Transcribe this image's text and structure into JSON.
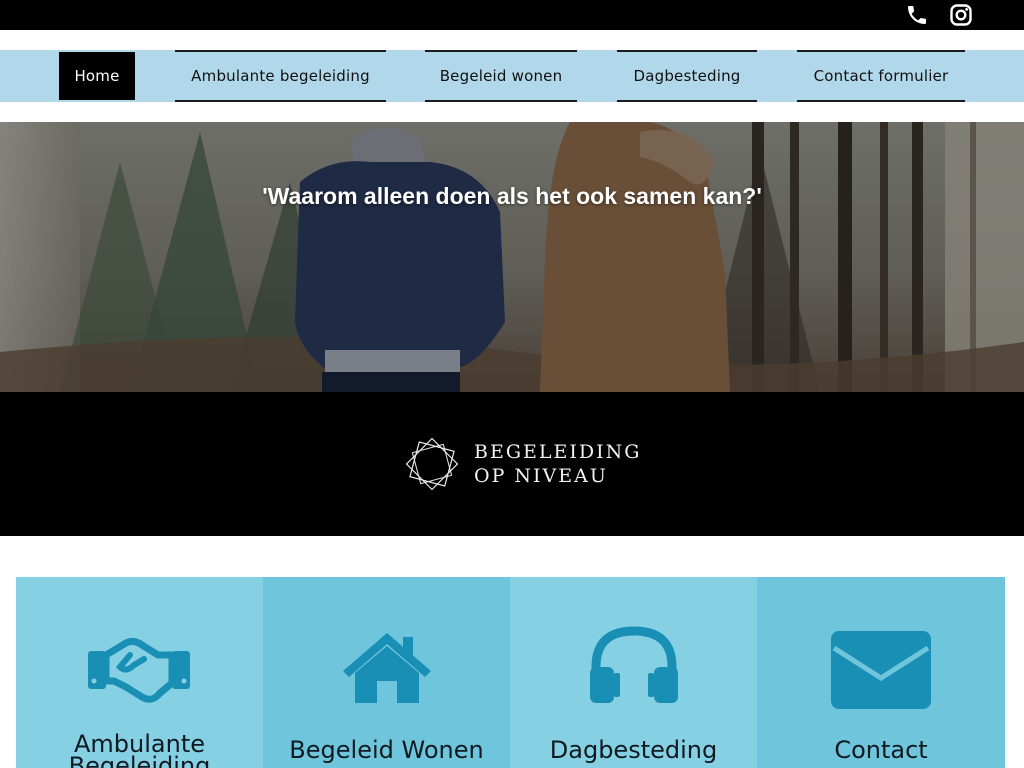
{
  "topbar": {
    "icons": [
      "phone-icon",
      "instagram-icon"
    ]
  },
  "nav": {
    "items": [
      {
        "label": "Home",
        "active": true
      },
      {
        "label": "Ambulante begeleiding",
        "active": false
      },
      {
        "label": "Begeleid wonen",
        "active": false
      },
      {
        "label": "Dagbesteding",
        "active": false
      },
      {
        "label": "Contact formulier",
        "active": false
      }
    ]
  },
  "hero": {
    "quote": "'Waarom alleen doen als het ook samen kan?'"
  },
  "brand": {
    "line1": "BEGELEIDING",
    "line2": "OP NIVEAU"
  },
  "tiles": [
    {
      "label": "Ambulante Begeleiding",
      "icon": "handshake-icon"
    },
    {
      "label": "Begeleid Wonen",
      "icon": "house-icon"
    },
    {
      "label": "Dagbesteding",
      "icon": "headphones-icon"
    },
    {
      "label": "Contact",
      "icon": "envelope-icon"
    }
  ],
  "colors": {
    "nav_bg": "#b1d8ea",
    "tile_light": "#86d0e4",
    "tile_dark": "#6ec5dc",
    "icon": "#1a8fb5"
  }
}
